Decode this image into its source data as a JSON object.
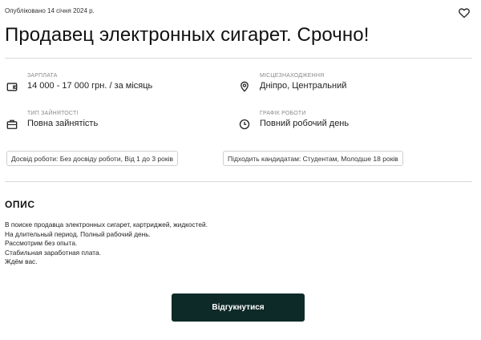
{
  "publish_date": "Опубліковано 14 січня 2024 р.",
  "title": "Продавец электронных сигарет. Срочно!",
  "info": {
    "salary": {
      "label": "ЗАРПЛАТА",
      "value": "14 000 - 17 000 грн. / за місяць",
      "icon": "wallet-icon"
    },
    "location": {
      "label": "МІСЦЕЗНАХОДЖЕННЯ",
      "value": "Дніпро, Центральний",
      "icon": "location-pin-icon"
    },
    "employment": {
      "label": "ТИП ЗАЙНЯТОСТІ",
      "value": "Повна зайнятість",
      "icon": "briefcase-icon"
    },
    "schedule": {
      "label": "ГРАФІК РОБОТИ",
      "value": "Повний робочий день",
      "icon": "clock-icon"
    }
  },
  "tags": [
    "Досвід роботи: Без досвіду роботи, Від 1 до 3 років",
    "Підходить кандидатам: Студентам, Молодше 18 років"
  ],
  "description": {
    "title": "ОПИС",
    "lines": [
      "В поиске продавца электронных сигарет, картриджей, жидкостей.",
      "На длительный период. Полный рабочий день.",
      "Рассмотрим без опыта.",
      "Стабильная заработная плата.",
      "Ждём вас."
    ]
  },
  "apply_button": "Відгукнутися",
  "colors": {
    "button_bg": "#0e2a28",
    "button_text": "#ffffff",
    "divider": "#d9d9d9"
  }
}
